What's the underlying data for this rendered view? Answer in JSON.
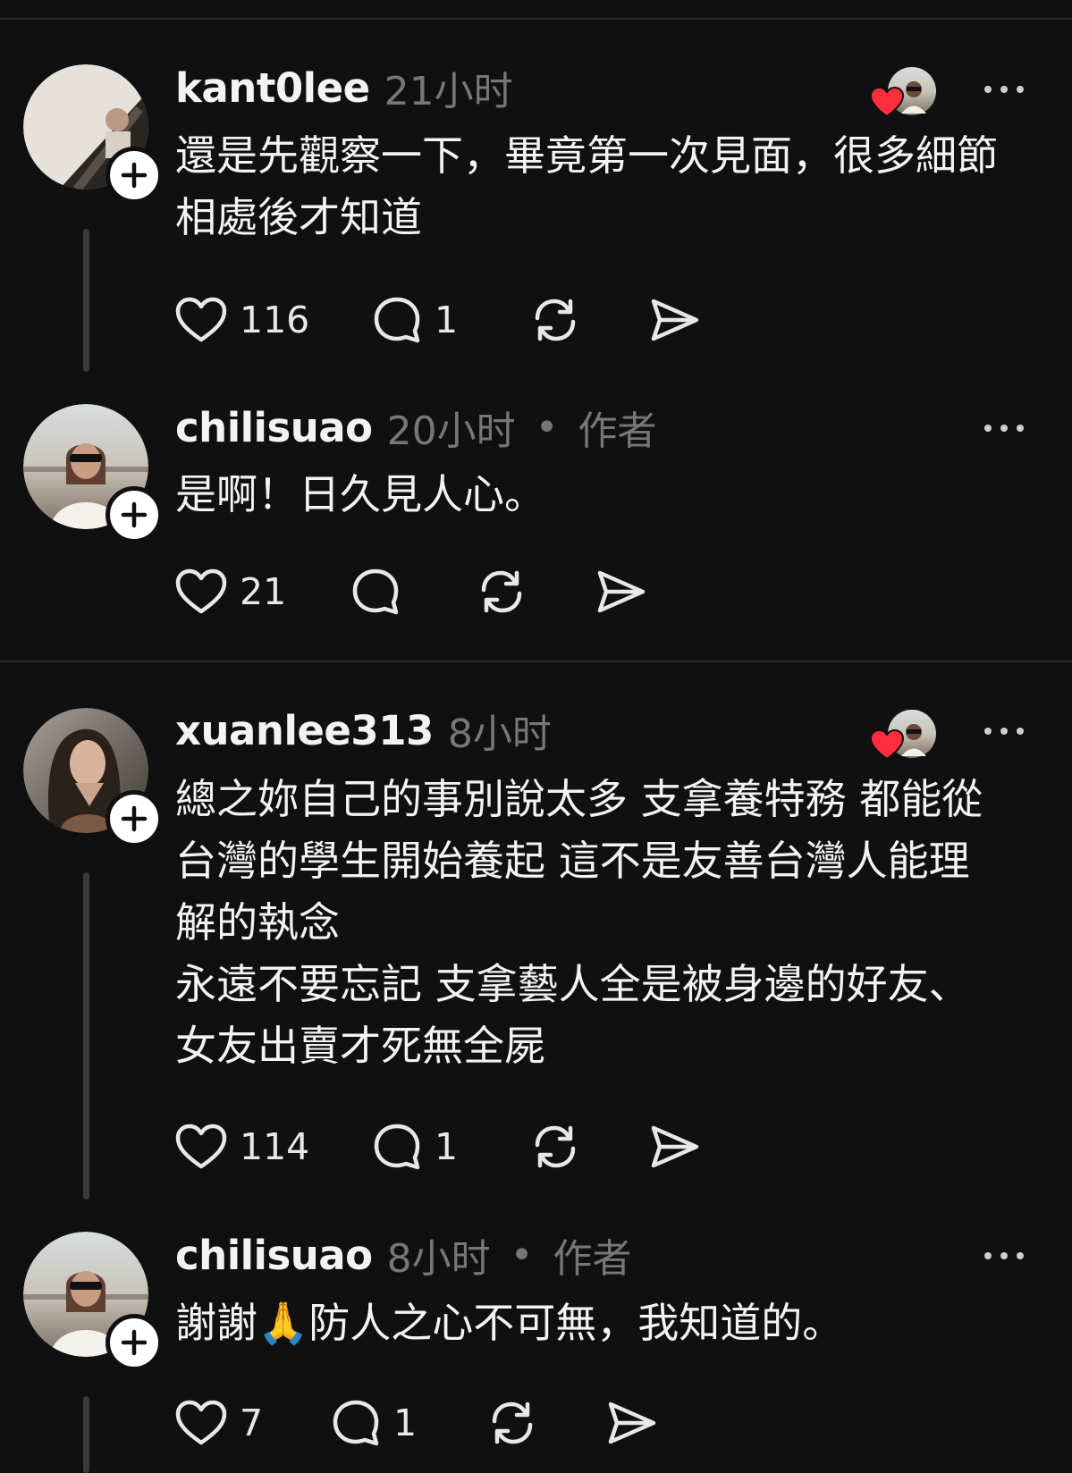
{
  "posts": [
    {
      "username": "kant0lee",
      "time": "21小时",
      "author_tag": "",
      "text": "還是先觀察一下，畢竟第一次見面，很多細節\n相處後才知道",
      "likes": "116",
      "replies": "1",
      "liked_by_author": true,
      "avatar_icon": "profile-photo-piano"
    },
    {
      "username": "chilisuao",
      "time": "20小时",
      "separator": "•",
      "author_tag": "作者",
      "text": "是啊！日久見人心。",
      "likes": "21",
      "replies": "",
      "liked_by_author": false,
      "avatar_icon": "profile-photo-sunglasses"
    },
    {
      "username": "xuanlee313",
      "time": "8小时",
      "author_tag": "",
      "text": "總之妳自己的事別說太多 支拿養特務 都能從\n台灣的學生開始養起 這不是友善台灣人能理\n解的執念\n永遠不要忘記 支拿藝人全是被身邊的好友、\n女友出賣才死無全屍",
      "likes": "114",
      "replies": "1",
      "liked_by_author": true,
      "avatar_icon": "profile-photo-long-hair"
    },
    {
      "username": "chilisuao",
      "time": "8小时",
      "separator": "•",
      "author_tag": "作者",
      "text": "謝謝🙏防人之心不可無，我知道的。",
      "likes": "7",
      "replies": "1",
      "liked_by_author": false,
      "avatar_icon": "profile-photo-sunglasses"
    }
  ],
  "icons": {
    "like": "heart-outline-icon",
    "reply": "speech-bubble-icon",
    "repost": "repost-arrows-icon",
    "share": "paper-plane-icon",
    "more": "more-dots-icon",
    "follow": "plus-icon",
    "liked_badge": "red-heart-icon"
  },
  "colors": {
    "background": "#101010",
    "text": "#f3f3f3",
    "muted": "#777777",
    "heart": "#ff2d3d"
  }
}
